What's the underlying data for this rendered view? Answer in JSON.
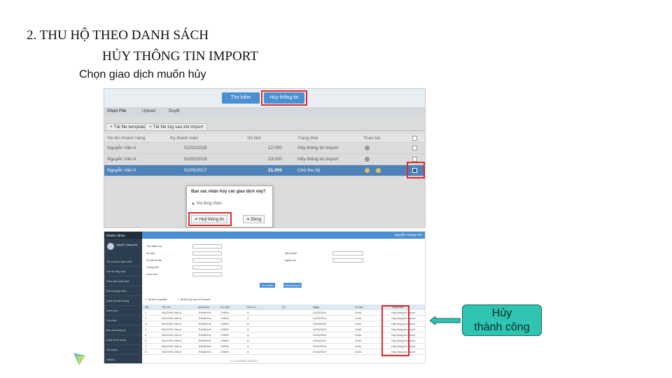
{
  "slide": {
    "title": "2. THU HỘ THEO DANH SÁCH",
    "subtitle": "HỦY THÔNG TIN IMPORT",
    "step": "Chọn giao dịch muốn hủy",
    "result_label": "Hủy\nthành công"
  },
  "top_screen": {
    "toolbar": {
      "search_label": "Tìm kiếm",
      "cancel_label": "Hủy thông tin"
    },
    "steps": [
      "Chọn File",
      "Upload",
      "Duyệt"
    ],
    "tabs": [
      "+ Tải file template",
      "+ Tải file log sau khi import"
    ],
    "columns": [
      "Họ tên khách hàng",
      "Kỳ thanh toán",
      "Số tiền",
      "Trạng thái",
      "Thao tác"
    ],
    "rows": [
      {
        "name": "Nguyễn Văn A",
        "period": "01/02/2018",
        "amount": "12.000",
        "status": "Hủy thông tin import",
        "checked": false
      },
      {
        "name": "Nguyễn Văn A",
        "period": "01/02/2019",
        "amount": "13.000",
        "status": "Hủy thông tin import",
        "checked": false
      },
      {
        "name": "Nguyễn Văn A",
        "period": "01/05/2017",
        "amount": "21.000",
        "status": "Chờ thu hộ",
        "checked": true
      }
    ],
    "dialog": {
      "question": "Bạn xác nhận hủy các giao dịch này?",
      "note": "Vui lòng chọn",
      "confirm_label": "Huỷ thông tin",
      "close_label": "Đóng"
    }
  },
  "bottom_screen": {
    "brand": "Ebank Admin",
    "user": "Nguyễn Hoàng Anh",
    "top_user": "Nguyễn Hoàng Anh",
    "menu": [
      "Thu hộ theo danh sách",
      "Lịch sử tổng hợp",
      "Danh sách giao dịch",
      "Đối soát giao dịch",
      "Quản lý khách hàng",
      "Danh mục",
      "Cấu hình",
      "Báo cáo thống kê",
      "Quản trị hệ thống",
      "Tài khoản",
      "Nhật ký"
    ],
    "form": {
      "l1": "Tên kiểm tra",
      "l2": "Kỳ hạn",
      "l3": "Số tài khoản",
      "l4": "Trạng thái",
      "l5": "Loại hình",
      "r1": "Mã khách",
      "r2": "Ngày tạo"
    },
    "buttons": {
      "search": "Tìm kiếm",
      "cancel": "Hủy thông tin"
    },
    "tabs": [
      "+ Tải file template",
      "+ Tải file log sau khi import"
    ],
    "grid_cols": [
      "Mã",
      "Tên KH",
      "Mã khách",
      "Số hiệu",
      "Dịch vụ",
      "Kỳ",
      "Ngày",
      "Số tiền",
      "Trạng thái"
    ],
    "grid_rows": [
      [
        "1",
        "NGUYEN VAN A",
        "THANHHA",
        "CHIEN",
        "A",
        "01/03/2019",
        "3,944",
        "Hủy thông tin import"
      ],
      [
        "2",
        "NGUYEN VAN A",
        "THANHHA",
        "CHIEN",
        "A",
        "01/03/2019",
        "3,944",
        "Hủy thông tin import"
      ],
      [
        "3",
        "NGUYEN VAN A",
        "THANHHA",
        "CHIEN",
        "A",
        "01/03/2019",
        "3,944",
        "Hủy thông tin import"
      ],
      [
        "4",
        "NGUYEN VAN A",
        "THANHHA",
        "CHIEN",
        "A",
        "01/03/2019",
        "3,944",
        "Hủy thông tin import"
      ],
      [
        "5",
        "NGUYEN VAN A",
        "THANHHA",
        "CHIEN",
        "A",
        "01/03/2019",
        "3,944",
        "Hủy thông tin import"
      ],
      [
        "6",
        "NGUYEN VAN A",
        "THANHHA",
        "CHIEN",
        "A",
        "01/03/2019",
        "3,944",
        "Hủy thông tin import"
      ],
      [
        "7",
        "NGUYEN VAN A",
        "THANHHA",
        "CHIEN",
        "A",
        "01/03/2019",
        "3,944",
        "Hủy thông tin import"
      ],
      [
        "8",
        "NGUYEN VAN A",
        "THANHHA",
        "CHIEN",
        "A",
        "01/03/2019",
        "3,944",
        "Hủy thông tin import"
      ]
    ],
    "pager": "« 1 2 3 4 5 6 7 8 9 10 »"
  },
  "colors": {
    "accent": "#4a8fd1",
    "highlight": "#e02a2a",
    "selected_row": "#4f82b8",
    "badge": "#2fc4b2"
  }
}
